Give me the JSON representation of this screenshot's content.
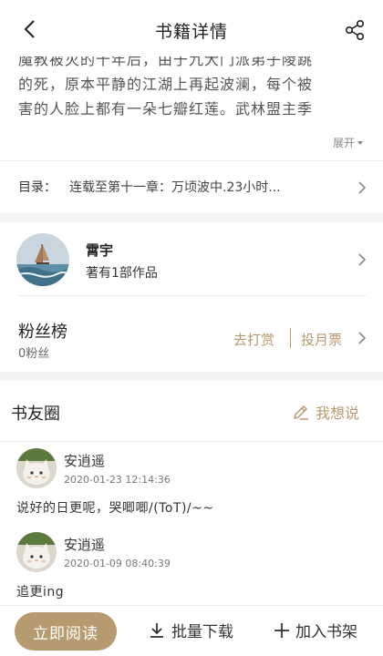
{
  "header": {
    "title": "书籍详情"
  },
  "synopsis": {
    "lines": [
      "魔教被灭的十年后，由于九大门派弟子陵跳",
      "的死，原本平静的江湖上再起波澜，每个被",
      "害的人脸上都有一朵七瓣红莲。武林盟主季"
    ],
    "expand_label": "展开"
  },
  "toc": {
    "label": "目录：",
    "chapter": "连载至第十一章：万顷波中.23小时..."
  },
  "author": {
    "name": "霄宇",
    "works": "著有1部作品"
  },
  "fans": {
    "title": "粉丝榜",
    "count": "0粉丝",
    "reward_label": "去打赏",
    "vote_label": "投月票"
  },
  "book_circle": {
    "title": "书友圈",
    "write_label": "我想说",
    "posts": [
      {
        "user": "安逍遥",
        "time": "2020-01-23 12:14:36",
        "content": "说好的日更呢，哭唧唧/(ToT)/~~"
      },
      {
        "user": "安逍遥",
        "time": "2020-01-09 08:40:39",
        "content": "追更ing"
      }
    ]
  },
  "bottom": {
    "read_label": "立即阅读",
    "download_label": "批量下载",
    "shelf_label": "加入书架"
  },
  "colors": {
    "accent": "#b79b70",
    "separator": "#f4f4f4"
  },
  "icons": [
    "back-icon",
    "share-icon",
    "chevron-right-icon",
    "pen-icon",
    "download-icon",
    "plus-icon"
  ]
}
